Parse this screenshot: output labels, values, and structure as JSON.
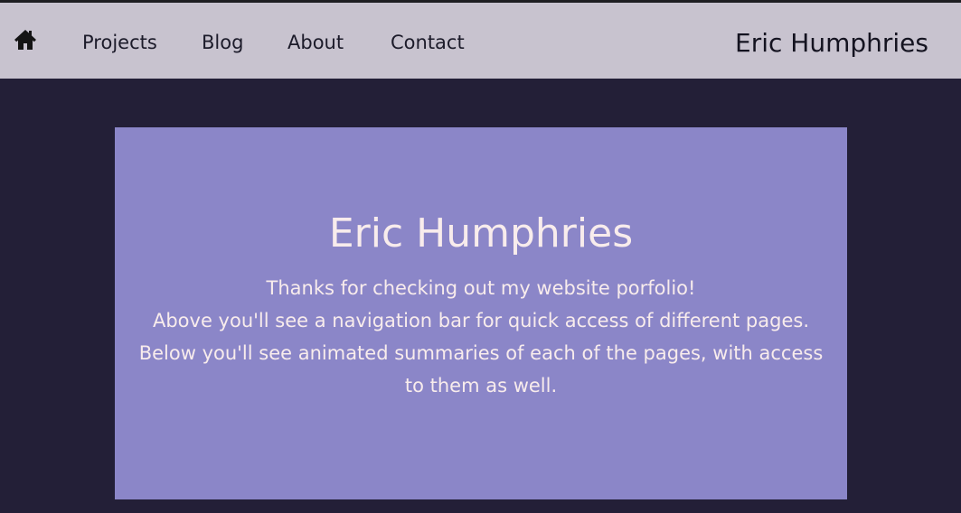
{
  "nav": {
    "home_icon": "home-icon",
    "links": [
      {
        "label": "Projects"
      },
      {
        "label": "Blog"
      },
      {
        "label": "About"
      },
      {
        "label": "Contact"
      }
    ],
    "brand": "Eric Humphries"
  },
  "hero": {
    "title": "Eric Humphries",
    "lines": [
      "Thanks for checking out my website porfolio!",
      "Above you'll see a navigation bar for quick access of different pages.",
      "Below you'll see animated summaries of each of the pages, with access to them as well."
    ]
  },
  "colors": {
    "page_background": "#231f37",
    "navbar_background": "#c8c3cf",
    "hero_background": "#8b86c8",
    "hero_text": "#f8ecec"
  }
}
